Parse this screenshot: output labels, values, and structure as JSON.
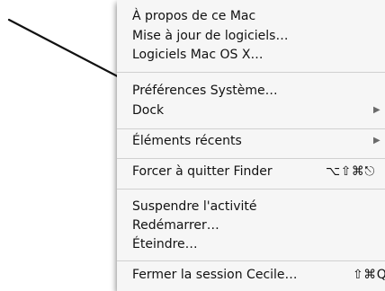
{
  "menu": {
    "items": [
      {
        "label": "À propos de ce Mac"
      },
      {
        "label": "Mise à jour de logiciels…"
      },
      {
        "label": "Logiciels Mac OS X…"
      },
      {
        "label": "Préférences Système…"
      },
      {
        "label": "Dock",
        "submenu_glyph": "▶"
      },
      {
        "label": "Éléments récents",
        "submenu_glyph": "▶"
      },
      {
        "label": "Forcer à quitter Finder",
        "shortcut": "⌥⇧⌘⎋"
      },
      {
        "label": "Suspendre l'activité"
      },
      {
        "label": "Redémarrer…"
      },
      {
        "label": "Éteindre…"
      },
      {
        "label": "Fermer la session Cecile…",
        "shortcut": "⇧⌘Q"
      }
    ]
  },
  "annotation": {
    "arrow_color": "#111111",
    "target": "menu-item-preferences-systeme"
  },
  "colors": {
    "menu_background": "#f6f6f6",
    "text": "#111111",
    "separator": "#d0d0d0"
  }
}
